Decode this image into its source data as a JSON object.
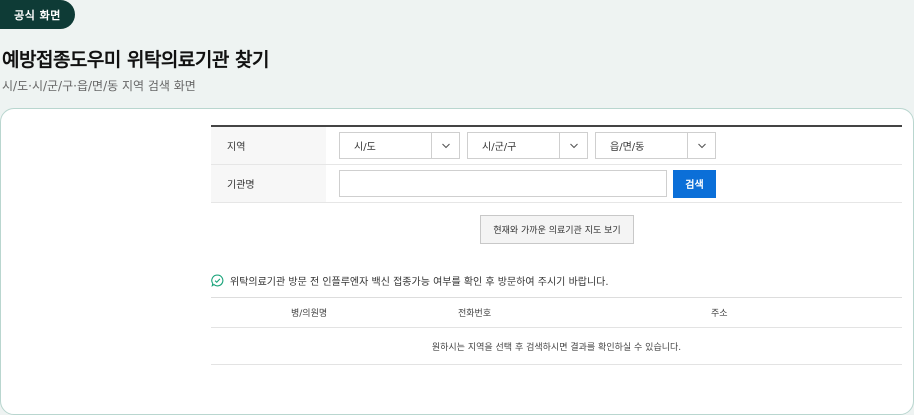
{
  "badge": {
    "label": "공식 화면"
  },
  "header": {
    "title": "예방접종도우미 위탁의료기관 찾기",
    "subtitle": "시/도·시/군/구·읍/면/동 지역 검색 화면"
  },
  "search_form": {
    "region_label": "지역",
    "selects": [
      {
        "value": "시/도"
      },
      {
        "value": "시/군/구"
      },
      {
        "value": "읍/면/동"
      }
    ],
    "institution_label": "기관명",
    "institution_value": "",
    "institution_placeholder": "",
    "search_button": "검색"
  },
  "map_button": {
    "label": "현재와 가까운 의료기관 지도 보기"
  },
  "notice": {
    "text": "위탁의료기관 방문 전 인플루엔자 백신 접종가능 여부를 확인 후 방문하여 주시기 바랍니다."
  },
  "results": {
    "columns": [
      "병/의원명",
      "전화번호",
      "주소"
    ],
    "empty_message": "원하시는 지역을 선택 후 검색하시면 결과를 확인하실 수 있습니다."
  },
  "colors": {
    "background": "#eef3f2",
    "badge": "#0e3b36",
    "accent_button": "#0b6fd8",
    "card_border": "#b9d6cf",
    "notice_icon": "#1aa37a"
  },
  "icons": {
    "select_chevron": "chevron-down-icon",
    "notice": "chat-bubble-check-icon"
  }
}
